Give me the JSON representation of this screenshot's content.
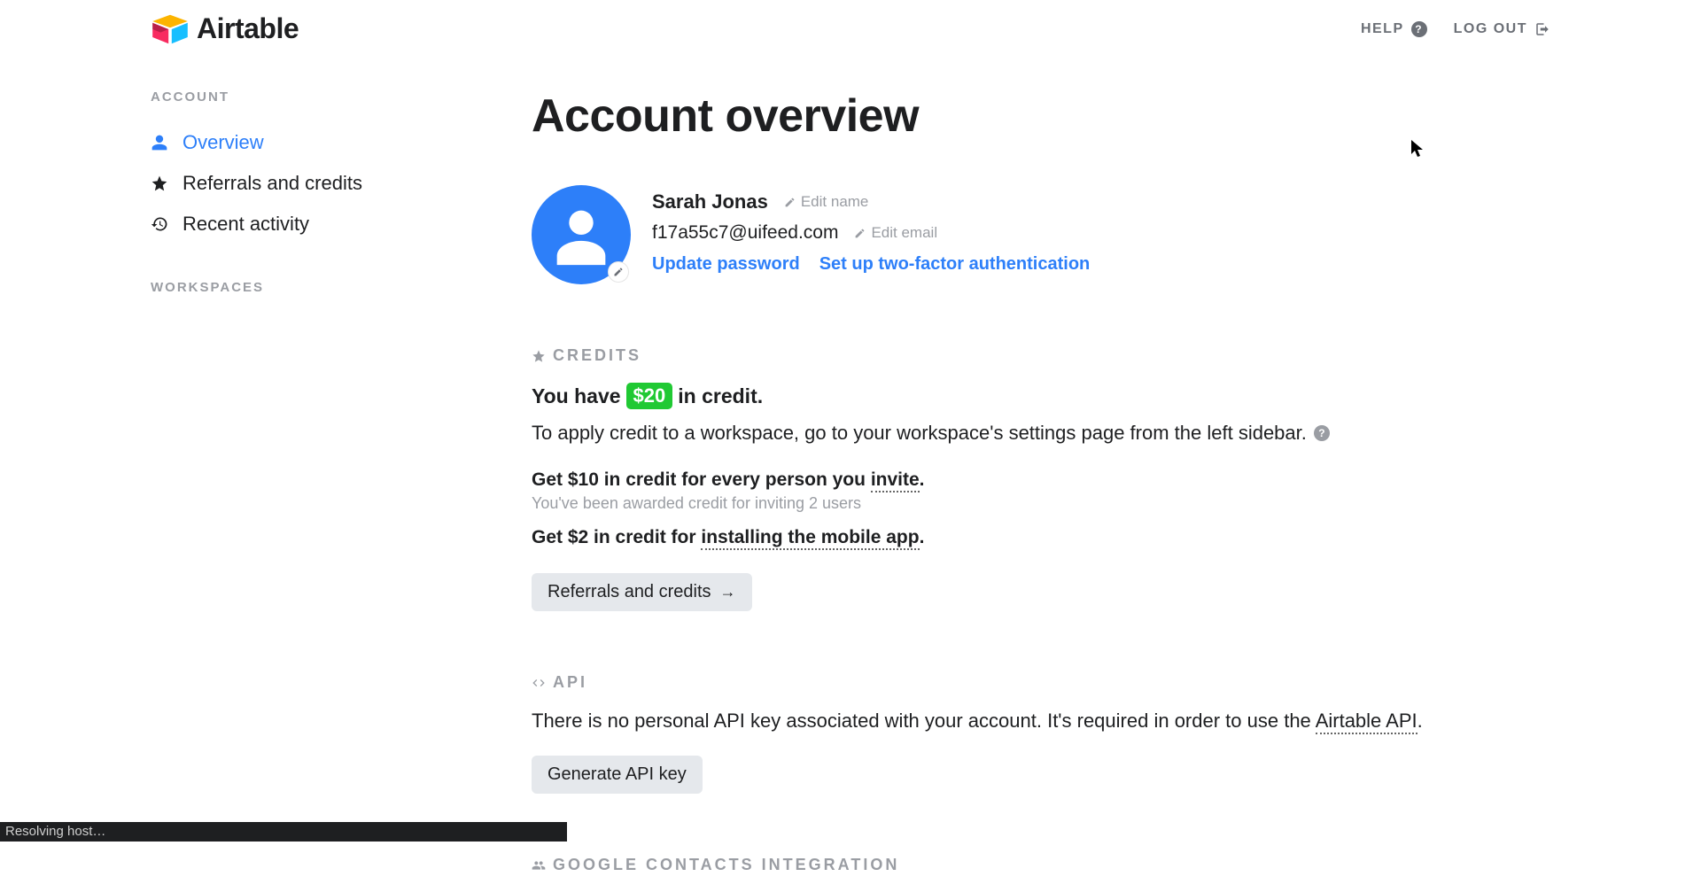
{
  "header": {
    "logo_text": "Airtable",
    "help_label": "HELP",
    "logout_label": "LOG OUT"
  },
  "sidebar": {
    "account_heading": "ACCOUNT",
    "items": [
      {
        "label": "Overview"
      },
      {
        "label": "Referrals and credits"
      },
      {
        "label": "Recent activity"
      }
    ],
    "workspaces_heading": "WORKSPACES"
  },
  "main": {
    "title": "Account overview",
    "profile": {
      "name": "Sarah Jonas",
      "email": "f17a55c7@uifeed.com",
      "edit_name_label": "Edit name",
      "edit_email_label": "Edit email",
      "update_password_label": "Update password",
      "two_factor_label": "Set up two-factor authentication"
    },
    "credits": {
      "heading": "CREDITS",
      "you_have_prefix": "You have",
      "amount": "$20",
      "you_have_suffix": "in credit.",
      "apply_text": "To apply credit to a workspace, go to your workspace's settings page from the left sidebar.",
      "invite_prefix": "Get $10 in credit for every person you ",
      "invite_link": "invite",
      "invite_suffix": ".",
      "awarded_text": "You've been awarded credit for inviting 2 users",
      "mobile_prefix": "Get $2 in credit for ",
      "mobile_link": "installing the mobile app",
      "mobile_suffix": ".",
      "button_label": "Referrals and credits"
    },
    "api": {
      "heading": "API",
      "text_prefix": "There is no personal API key associated with your account. It's required in order to use the ",
      "text_link": "Airtable API",
      "text_suffix": ".",
      "button_label": "Generate API key"
    },
    "google": {
      "heading": "GOOGLE CONTACTS INTEGRATION"
    }
  },
  "status": {
    "text": "Resolving host…"
  }
}
